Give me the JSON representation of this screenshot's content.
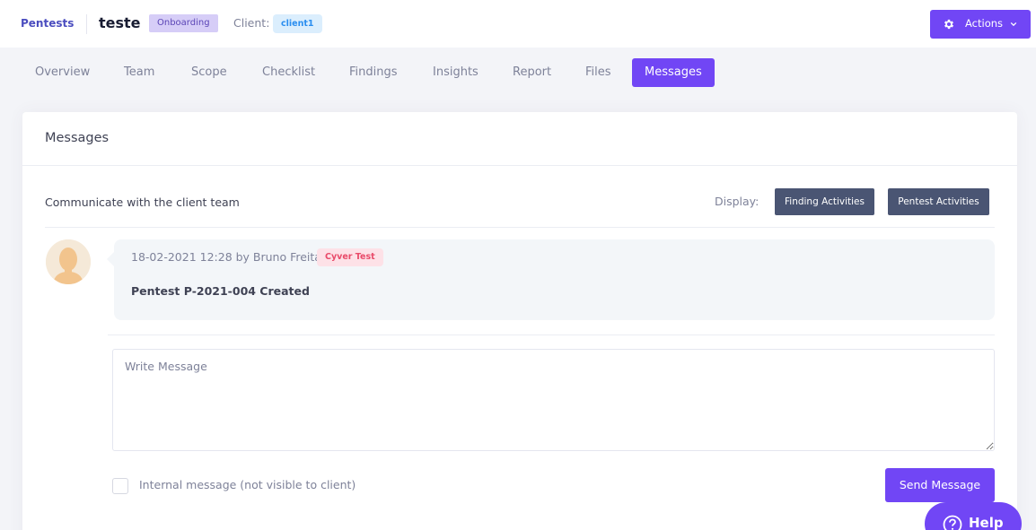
{
  "header": {
    "brand": "Pentests",
    "pentest_name": "teste",
    "status_badge": "Onboarding",
    "client_label": "Client:",
    "client_name": "client1",
    "actions_label": "Actions"
  },
  "tabs": [
    {
      "label": "Overview",
      "active": false
    },
    {
      "label": "Team",
      "active": false
    },
    {
      "label": "Scope",
      "active": false
    },
    {
      "label": "Checklist",
      "active": false
    },
    {
      "label": "Findings",
      "active": false
    },
    {
      "label": "Insights",
      "active": false
    },
    {
      "label": "Report",
      "active": false
    },
    {
      "label": "Files",
      "active": false
    },
    {
      "label": "Messages",
      "active": true
    }
  ],
  "messages_card": {
    "title": "Messages",
    "subtitle": "Communicate with the client team",
    "display_label": "Display:",
    "filter_buttons": [
      "Finding Activities",
      "Pentest Activities"
    ],
    "messages": [
      {
        "meta": "18-02-2021 12:28 by Bruno Freitas",
        "author_badge": "Cyver Test",
        "text": "Pentest P-2021-004 Created"
      }
    ],
    "input_placeholder": "Write Message",
    "internal_checkbox_label": "Internal message (not visible to client)",
    "internal_checked": false,
    "send_label": "Send Message"
  },
  "help": {
    "label": "Help"
  },
  "colors": {
    "primary": "#7146f5",
    "brand": "#4b4dbf",
    "filter_button": "#4a5573",
    "onboarding_badge_bg": "#d6cdf7",
    "client_badge_bg": "#dbeefd",
    "author_badge_bg": "#fde1e7",
    "page_bg": "#f3f4f8"
  },
  "icons": {
    "actions": "gear-icon",
    "actions_caret": "chevron-down-icon",
    "avatar": "user-silhouette",
    "help": "question-circle-icon"
  }
}
